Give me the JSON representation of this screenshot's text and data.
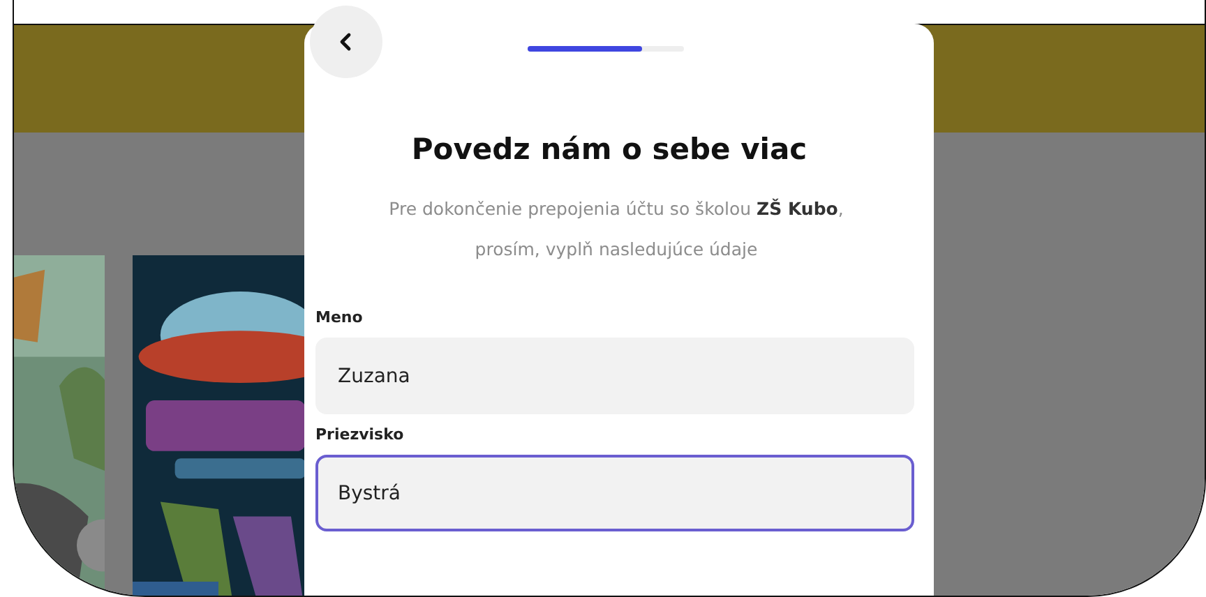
{
  "dialog": {
    "progress": {
      "level": 0.73
    },
    "title": "Povedz nám o sebe viac",
    "subtitle": "Pre dokončenie prepojenia účtu so školou **ZŠ Kubo**, prosím, vyplň nasledujúce údaje",
    "fields": [
      {
        "label": "Meno",
        "value": "Zuzana",
        "focused": false
      },
      {
        "label": "Priezvisko",
        "value": "Bystrá",
        "focused": true
      }
    ]
  }
}
